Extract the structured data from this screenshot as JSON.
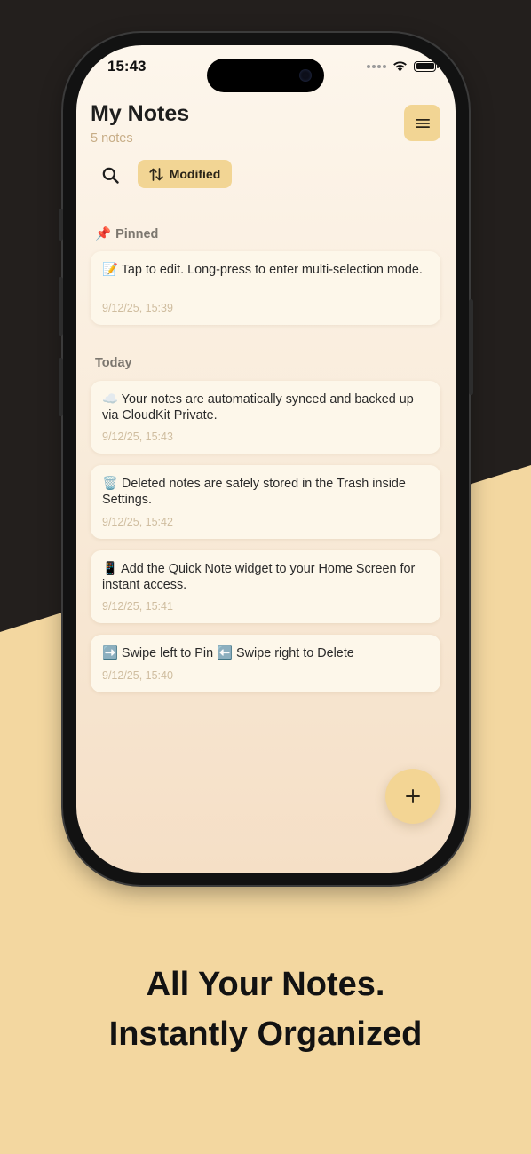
{
  "status_bar": {
    "time": "15:43"
  },
  "header": {
    "title": "My Notes",
    "subtitle": "5 notes"
  },
  "toolbar": {
    "sort_label": "Modified"
  },
  "sections": {
    "pinned_label": "Pinned",
    "today_label": "Today"
  },
  "notes": [
    {
      "emoji": "📝",
      "text": "Tap to edit. Long-press to enter multi-selection mode.",
      "date": "9/12/25, 15:39"
    },
    {
      "emoji": "☁️",
      "text": "Your notes are automatically synced and backed up via CloudKit Private.",
      "date": "9/12/25, 15:43"
    },
    {
      "emoji": "🗑️",
      "text": "Deleted notes are safely stored in the Trash inside Settings.",
      "date": "9/12/25, 15:42"
    },
    {
      "emoji": "📱",
      "text": "Add the Quick Note widget to your Home Screen for instant access.",
      "date": "9/12/25, 15:41"
    },
    {
      "emoji": "➡️",
      "text": "Swipe left to Pin",
      "emoji2": "⬅️",
      "text2": "Swipe right to Delete",
      "date": "9/12/25, 15:40"
    }
  ],
  "marketing": {
    "headline_line1": "All Your Notes.",
    "headline_line2": "Instantly Organized"
  },
  "colors": {
    "accent": "#f2d594",
    "background_light": "#f3d7a0",
    "background_dark": "#231f1d"
  },
  "icons": {
    "menu": "hamburger-icon",
    "search": "search-icon",
    "sort": "sort-arrows-icon",
    "pinned": "pushpin-icon",
    "add": "plus-icon"
  }
}
